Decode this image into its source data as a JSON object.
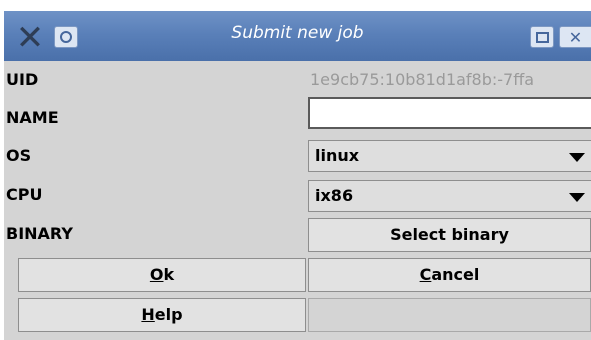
{
  "window": {
    "title": "Submit new job"
  },
  "form": {
    "uid": {
      "label": "UID",
      "value": "1e9cb75:10b81d1af8b:-7ffa"
    },
    "name": {
      "label": "NAME",
      "value": ""
    },
    "os": {
      "label": "OS",
      "value": "linux"
    },
    "cpu": {
      "label": "CPU",
      "value": "ix86"
    },
    "binary": {
      "label": "BINARY",
      "button": "Select binary"
    }
  },
  "buttons": {
    "ok_mnemonic": "O",
    "ok_rest": "k",
    "cancel_mnemonic": "C",
    "cancel_rest": "ancel",
    "help_mnemonic": "H",
    "help_rest": "elp"
  },
  "icons": {
    "app": "x-logo-icon",
    "menu": "window-menu-icon",
    "maximize": "maximize-icon",
    "close": "close-icon"
  }
}
